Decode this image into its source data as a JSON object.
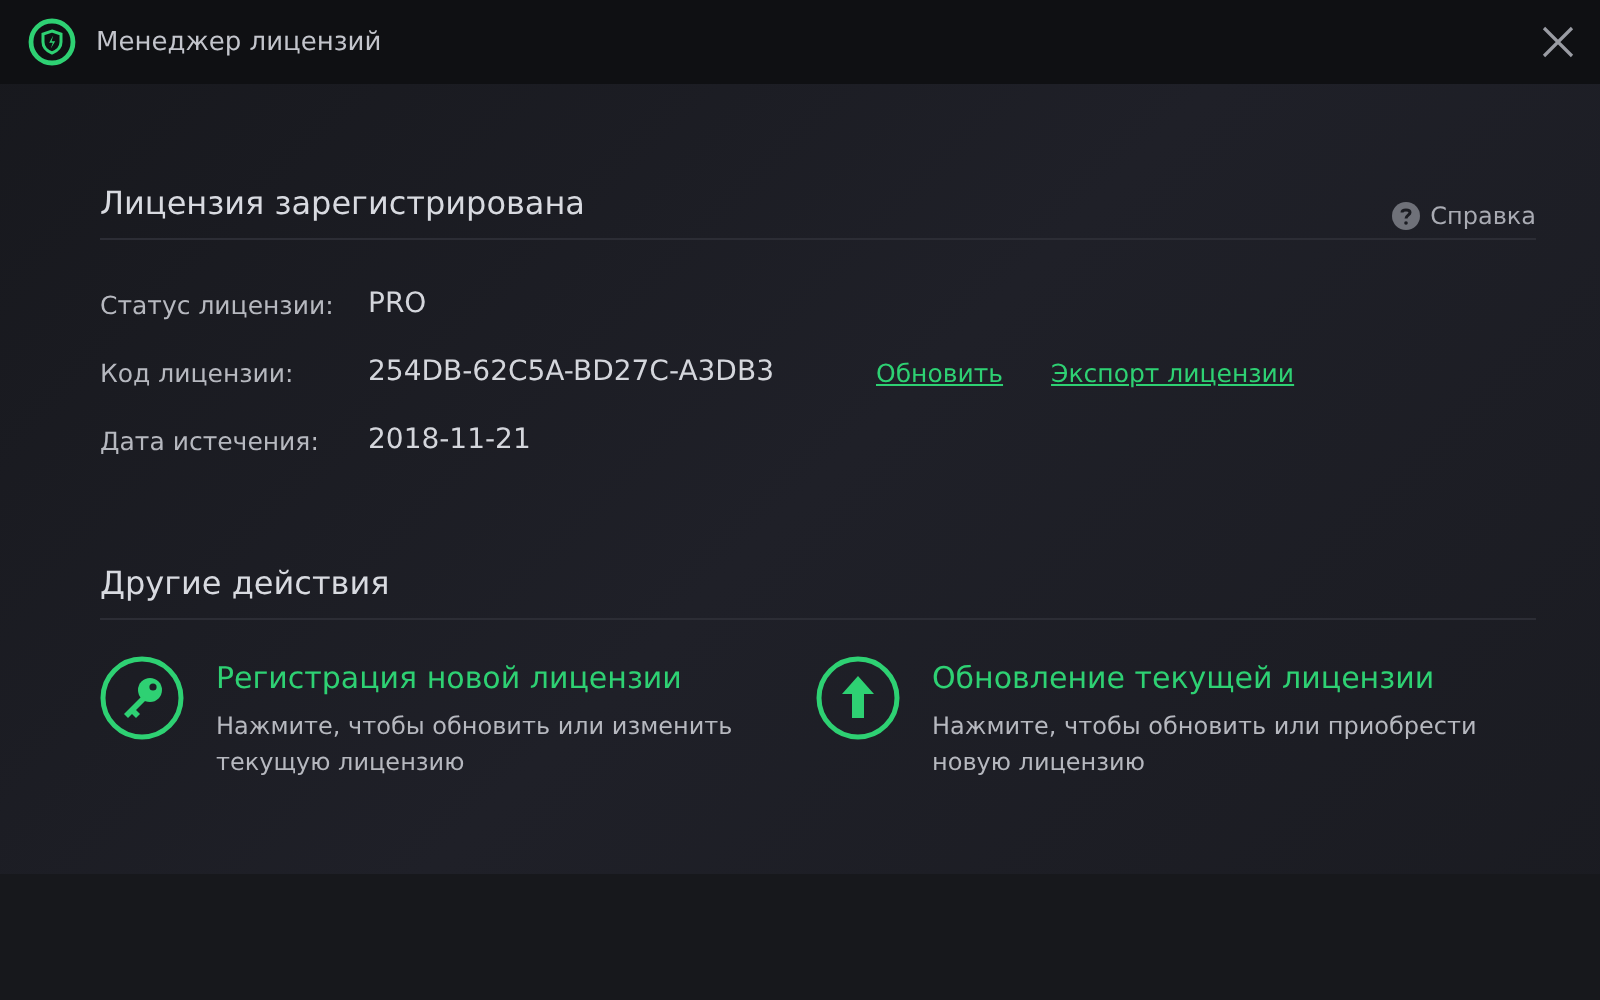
{
  "window": {
    "title": "Менеджер лицензий"
  },
  "license": {
    "heading": "Лицензия зарегистрирована",
    "help": "Справка",
    "rows": [
      {
        "label": "Статус лицензии:",
        "value": "PRO",
        "links": []
      },
      {
        "label": "Код лицензии:",
        "value": "254DB-62C5A-BD27C-A3DB3",
        "links": [
          "Обновить",
          "Экспорт лицензии"
        ]
      },
      {
        "label": "Дата истечения:",
        "value": "2018-11-21",
        "links": []
      }
    ]
  },
  "actions": {
    "heading": "Другие действия",
    "items": [
      {
        "kind": "key",
        "title": "Регистрация новой лицензии",
        "description": "Нажмите, чтобы обновить или изменить текущую лицензию"
      },
      {
        "kind": "upgrade",
        "title": "Обновление текущей лицензии",
        "description": "Нажмите, чтобы обновить или приобрести новую лицензию"
      }
    ]
  }
}
